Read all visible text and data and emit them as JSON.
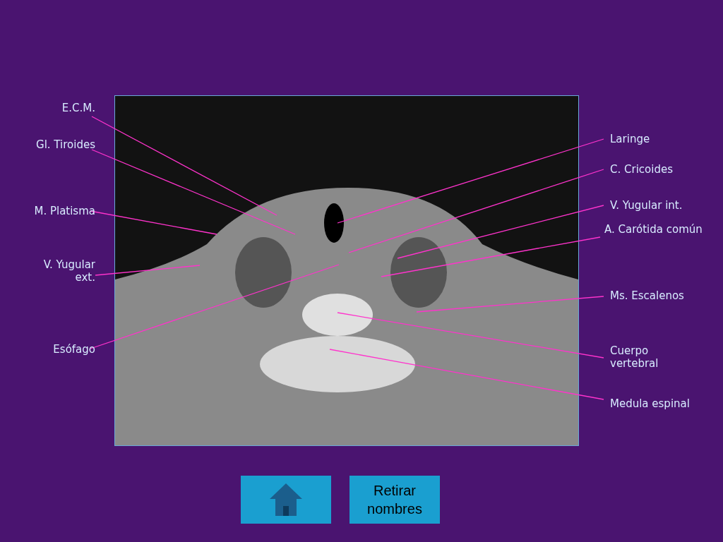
{
  "left_labels": [
    {
      "text": "E.C.M."
    },
    {
      "text": "Gl. Tiroides"
    },
    {
      "text": "M. Platisma"
    },
    {
      "text": "V. Yugular\next."
    },
    {
      "text": "Esófago"
    }
  ],
  "right_labels": [
    {
      "text": "Laringe"
    },
    {
      "text": "C. Cricoides"
    },
    {
      "text": "V. Yugular int."
    },
    {
      "text": "A. Carótida común"
    },
    {
      "text": "Ms. Escalenos"
    },
    {
      "text": "Cuerpo\nvertebral"
    },
    {
      "text": "Medula espinal"
    }
  ],
  "buttons": {
    "names_toggle": "Retirar\nnombres"
  }
}
